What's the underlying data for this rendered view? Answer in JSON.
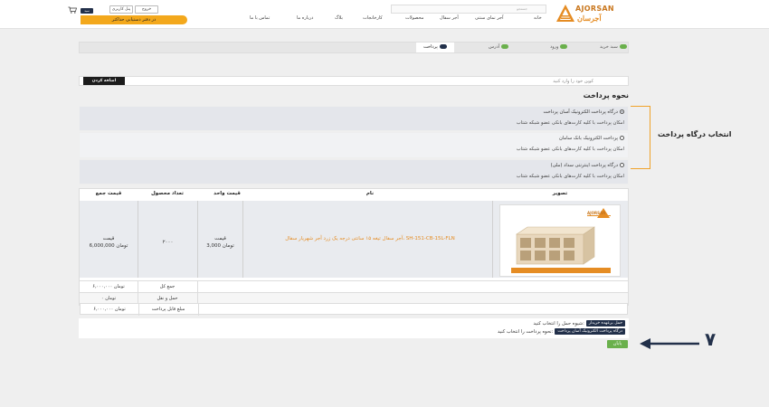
{
  "header": {
    "logo_en": "AJORSAN",
    "logo_fa": "آجرسان",
    "search_placeholder": "جستجو",
    "nav": [
      "خانه",
      "آجر نمای سنتی",
      "آجر سفال",
      "محصولات",
      "کارخانجات",
      "بلاگ",
      "درباره ما",
      "تماس با ما"
    ],
    "logout_label": "خروج",
    "profile_label": "پنل کاربری",
    "cart_label": "سبد",
    "category_bar": "در دفتر دستیابی حداکثر"
  },
  "steps": [
    {
      "label": "سبد خرید",
      "num": "1"
    },
    {
      "label": "ورود",
      "num": "2"
    },
    {
      "label": "آدرس",
      "num": "3"
    },
    {
      "label": "پرداخت",
      "num": "4"
    }
  ],
  "coupon": {
    "placeholder": "کوپن خود را وارد کنید",
    "button": "اضافه کردن"
  },
  "payment": {
    "title": "نحوه پرداخت",
    "options": [
      {
        "label": "درگاه پرداخت الکترونیک آسان پرداخت",
        "desc": "امکان پرداخت با کلیه کارت‌های بانکی عضو شبکه شتاب",
        "selected": true
      },
      {
        "label": "پرداخت الکترونیک بانک سامان",
        "desc": "امکان پرداخت با کلیه کارت‌های بانکی عضو شبکه شتاب",
        "selected": false
      },
      {
        "label": "درگاه پرداخت اینترنتی سداد (ملی)",
        "desc": "امکان پرداخت با کلیه کارت‌های بانکی عضو شبکه شتاب",
        "selected": false
      }
    ]
  },
  "annotation": {
    "label": "انتخاب درگاه پرداخت",
    "step_number": "۷"
  },
  "table": {
    "headers": {
      "image": "تصویر",
      "name": "نام",
      "unit_price": "قیمت واحد",
      "quantity": "تعداد محصول",
      "total": "قیمت جمع"
    },
    "row": {
      "product_name": "آجر سفال تیغه ۱۵ سانتی درجه یک زرد آجر شهریار سفال، SH-151-CB-15L-FLN",
      "unit_price_label": "قیمت",
      "unit_price_value": "3,000 تومان",
      "quantity": "۲۰۰۰",
      "total_label": "قیمت",
      "total_value": "6,000,000 تومان",
      "image_caption": "آجر سفال تیغه ۱۵ سانتی درجه یک زرد آجر شهریار سفال"
    },
    "summary": [
      {
        "label": "جمع کل",
        "value": "۶,۰۰۰,۰۰۰ تومان"
      },
      {
        "label": "حمل و نقل",
        "value": "۰ تومان"
      },
      {
        "label": "مبلغ قابل پرداخت",
        "value": "۶,۰۰۰,۰۰۰ تومان"
      }
    ]
  },
  "footer": {
    "shipping_prompt": "شیوه حمل را انتخاب کنید:",
    "shipping_choice": "حمل برعهده خریدار",
    "payment_prompt": "نحوه پرداخت را انتخاب کنید:",
    "payment_choice": "درگاه پرداخت الکترونیک آسان پرداخت",
    "finish_button": "پایان"
  },
  "colors": {
    "accent": "#f3a81c",
    "navy": "#22304a",
    "green": "#6ab04c",
    "orange_text": "#e58c23"
  }
}
